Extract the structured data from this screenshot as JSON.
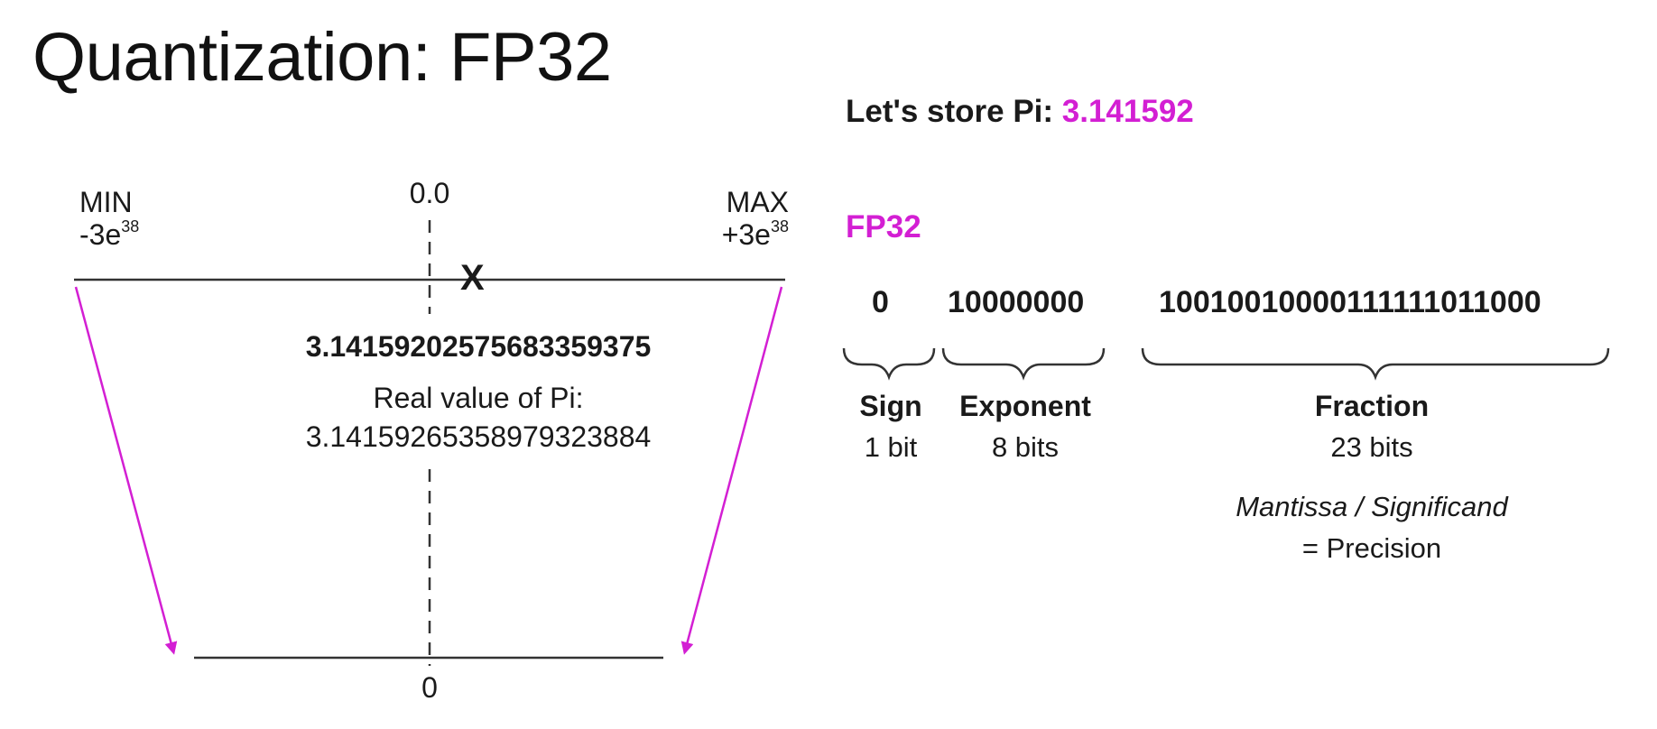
{
  "title": "Quantization: FP32",
  "store": {
    "prefix": "Let's store Pi: ",
    "value": "3.141592"
  },
  "format_label": "FP32",
  "range": {
    "min_label": "MIN",
    "min_value": "-3e",
    "min_exp": "38",
    "max_label": "MAX",
    "max_value": "+3e",
    "max_exp": "38",
    "zero_top": "0.0",
    "zero_bottom": "0",
    "marker": "X"
  },
  "stored_value": "3.14159202575683359375",
  "real_label": "Real value of Pi:",
  "real_value": "3.14159265358979323884",
  "bits": {
    "sign": "0",
    "exponent": "10000000",
    "fraction": "10010010000111111011000"
  },
  "fields": {
    "sign": {
      "name": "Sign",
      "size": "1 bit"
    },
    "exponent": {
      "name": "Exponent",
      "size": "8 bits"
    },
    "fraction": {
      "name": "Fraction",
      "size": "23 bits"
    }
  },
  "mantissa_note": "Mantissa / Significand",
  "precision_note": "= Precision",
  "colors": {
    "accent": "#d31fd3",
    "text": "#1a1a1a",
    "line": "#333333"
  }
}
